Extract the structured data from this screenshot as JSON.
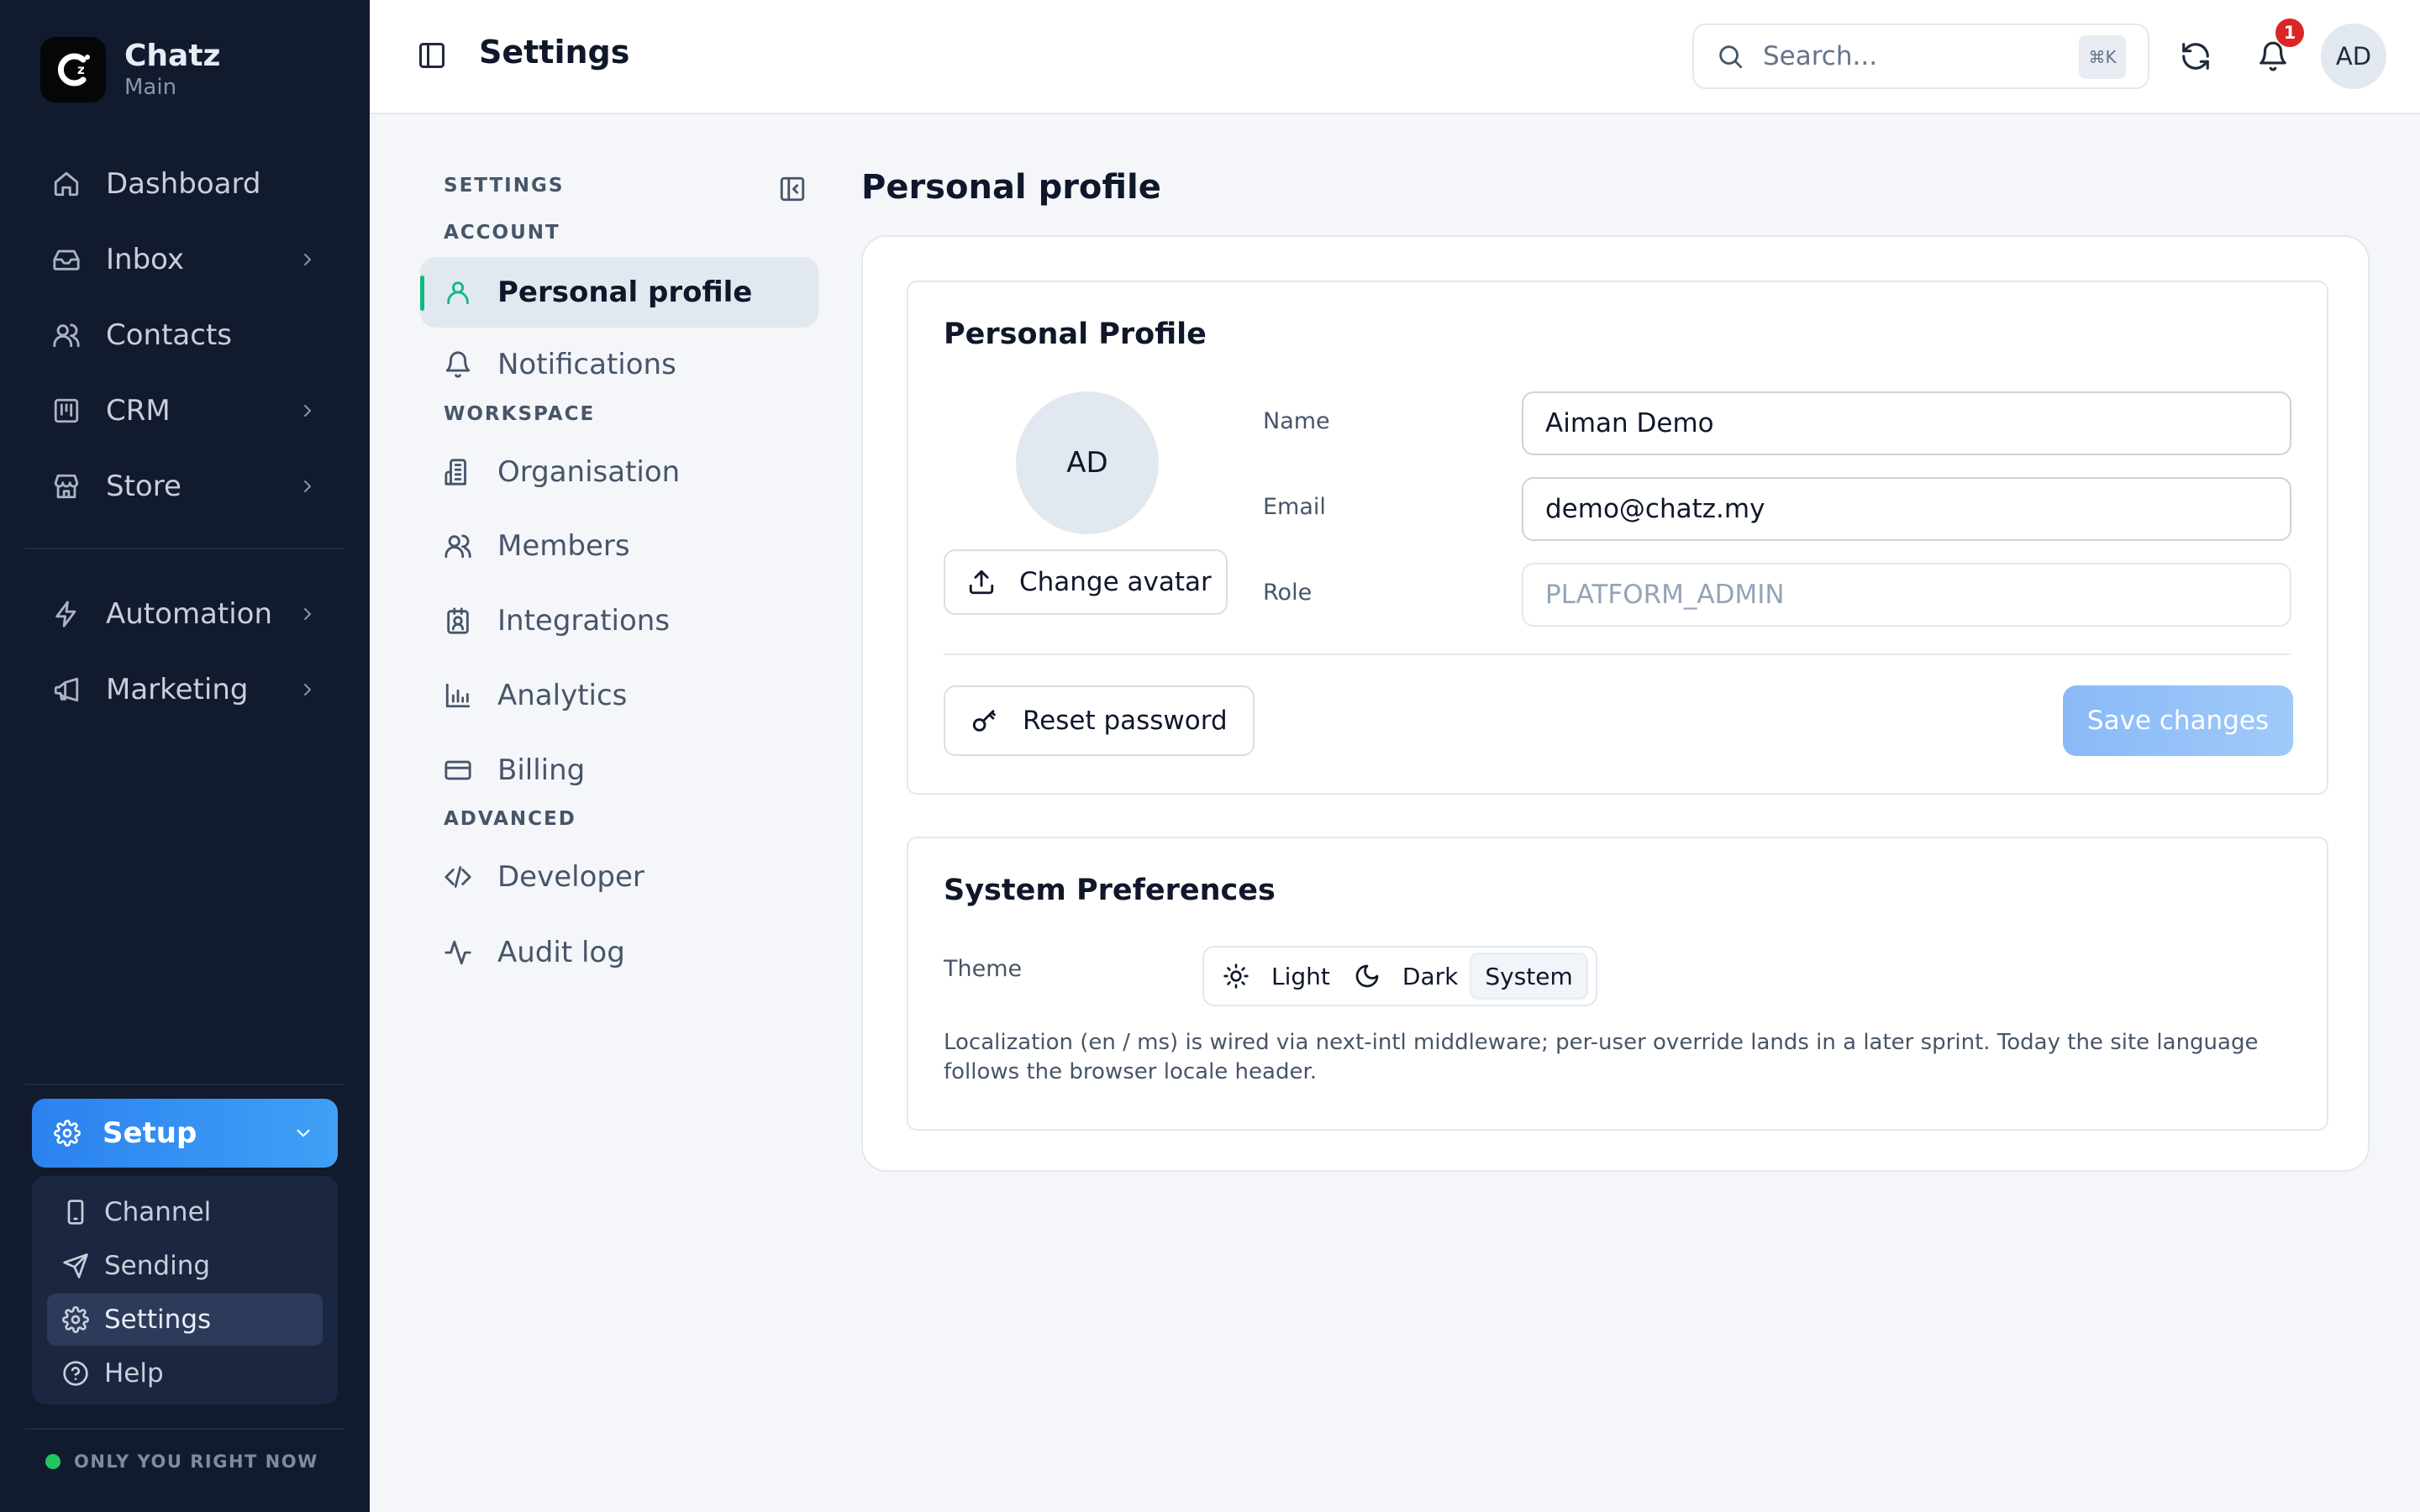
{
  "brand": {
    "name": "Chatz",
    "workspace": "Main",
    "logo_icon": "chatz-logo-icon"
  },
  "sidebar": {
    "items": [
      {
        "label": "Dashboard",
        "icon": "home-icon"
      },
      {
        "label": "Inbox",
        "icon": "inbox-icon"
      },
      {
        "label": "Contacts",
        "icon": "users-icon"
      },
      {
        "label": "CRM",
        "icon": "kanban-icon"
      },
      {
        "label": "Store",
        "icon": "store-icon"
      },
      {
        "label": "Automation",
        "icon": "zap-icon"
      },
      {
        "label": "Marketing",
        "icon": "megaphone-icon"
      }
    ],
    "setup": {
      "label": "Setup",
      "items": [
        {
          "label": "Channel",
          "icon": "smartphone-icon"
        },
        {
          "label": "Sending",
          "icon": "send-icon"
        },
        {
          "label": "Settings",
          "icon": "gear-icon"
        },
        {
          "label": "Help",
          "icon": "help-circle-icon"
        }
      ]
    },
    "status": {
      "text": "ONLY YOU RIGHT NOW",
      "color": "#22c55e"
    }
  },
  "header": {
    "title": "Settings",
    "search": {
      "placeholder": "Search...",
      "shortcut": "⌘K"
    },
    "notification_count": "1",
    "user_initials": "AD"
  },
  "settings_nav": {
    "heading": "SETTINGS",
    "sections": [
      {
        "title": "ACCOUNT",
        "items": [
          {
            "label": "Personal profile",
            "icon": "user-icon"
          },
          {
            "label": "Notifications",
            "icon": "bell-icon"
          }
        ]
      },
      {
        "title": "WORKSPACE",
        "items": [
          {
            "label": "Organisation",
            "icon": "building-icon"
          },
          {
            "label": "Members",
            "icon": "users-icon"
          },
          {
            "label": "Integrations",
            "icon": "integration-icon"
          },
          {
            "label": "Analytics",
            "icon": "bar-chart-icon"
          },
          {
            "label": "Billing",
            "icon": "credit-card-icon"
          }
        ]
      },
      {
        "title": "ADVANCED",
        "items": [
          {
            "label": "Developer",
            "icon": "code-icon"
          },
          {
            "label": "Audit log",
            "icon": "activity-icon"
          }
        ]
      }
    ]
  },
  "main": {
    "title": "Personal profile",
    "profile_card": {
      "title": "Personal Profile",
      "avatar_initials": "AD",
      "change_avatar": "Change avatar",
      "fields": {
        "name": {
          "label": "Name",
          "value": "Aiman Demo"
        },
        "email": {
          "label": "Email",
          "value": "demo@chatz.my"
        },
        "role": {
          "label": "Role",
          "value": "PLATFORM_ADMIN"
        }
      },
      "reset_password": "Reset password",
      "save": "Save changes"
    },
    "preferences_card": {
      "title": "System Preferences",
      "theme_label": "Theme",
      "theme_options": [
        {
          "label": "Light",
          "icon": "sun-icon"
        },
        {
          "label": "Dark",
          "icon": "moon-icon"
        },
        {
          "label": "System",
          "icon": ""
        }
      ],
      "theme_selected": "System",
      "note": "Localization (en / ms) is wired via next-intl middleware; per-user override lands in a later sprint. Today the site language follows the browser locale header."
    }
  },
  "colors": {
    "sidebar_bg": "#121a2e",
    "accent": "#2b82ef",
    "active_indicator": "#10b981",
    "badge": "#dc2626"
  }
}
